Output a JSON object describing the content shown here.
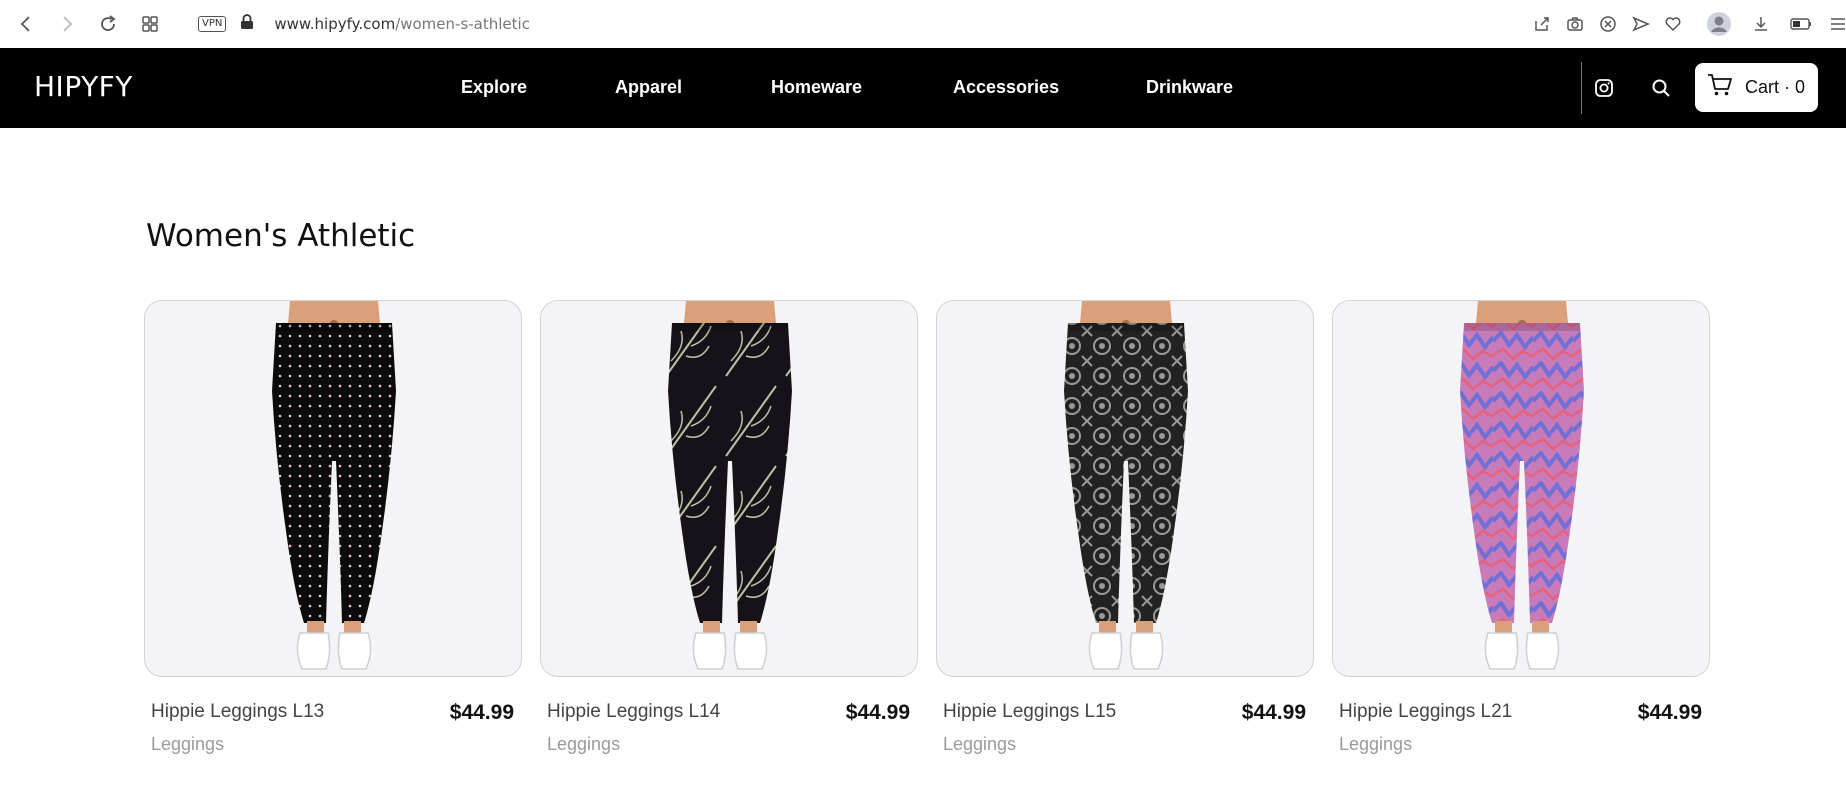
{
  "browser": {
    "vpn_label": "VPN",
    "url_domain": "www.hipyfy.com",
    "url_path": "/women-s-athletic"
  },
  "header": {
    "logo": "HIPYFY",
    "nav": [
      "Explore",
      "Apparel",
      "Homeware",
      "Accessories",
      "Drinkware"
    ],
    "cart_label": "Cart · 0"
  },
  "page": {
    "title": "Women's Athletic"
  },
  "products": [
    {
      "name": "Hippie Leggings L13",
      "price": "$44.99",
      "category": "Leggings",
      "pattern": "dots",
      "colors": [
        "#0b0b0b",
        "#e8c8d4"
      ]
    },
    {
      "name": "Hippie Leggings L14",
      "price": "$44.99",
      "category": "Leggings",
      "pattern": "leaves",
      "colors": [
        "#171219",
        "#b9c2a0"
      ]
    },
    {
      "name": "Hippie Leggings L15",
      "price": "$44.99",
      "category": "Leggings",
      "pattern": "medallion",
      "colors": [
        "#222222",
        "#9a9a9a"
      ]
    },
    {
      "name": "Hippie Leggings L21",
      "price": "$44.99",
      "category": "Leggings",
      "pattern": "zigzag",
      "colors": [
        "#c77bb8",
        "#6f6fd6"
      ]
    }
  ],
  "colors": {
    "header_bg": "#000000",
    "card_bg": "#f4f4f6",
    "card_border": "#d4d4d8",
    "muted_text": "#9a9a9a"
  },
  "icons": [
    "back-arrow-icon",
    "forward-arrow-icon",
    "reload-icon",
    "tabs-grid-icon",
    "lock-icon",
    "share-icon",
    "camera-icon",
    "shield-x-icon",
    "send-icon",
    "heart-icon",
    "profile-avatar-icon",
    "download-icon",
    "battery-icon",
    "menu-icon",
    "instagram-icon",
    "search-icon",
    "cart-icon"
  ]
}
